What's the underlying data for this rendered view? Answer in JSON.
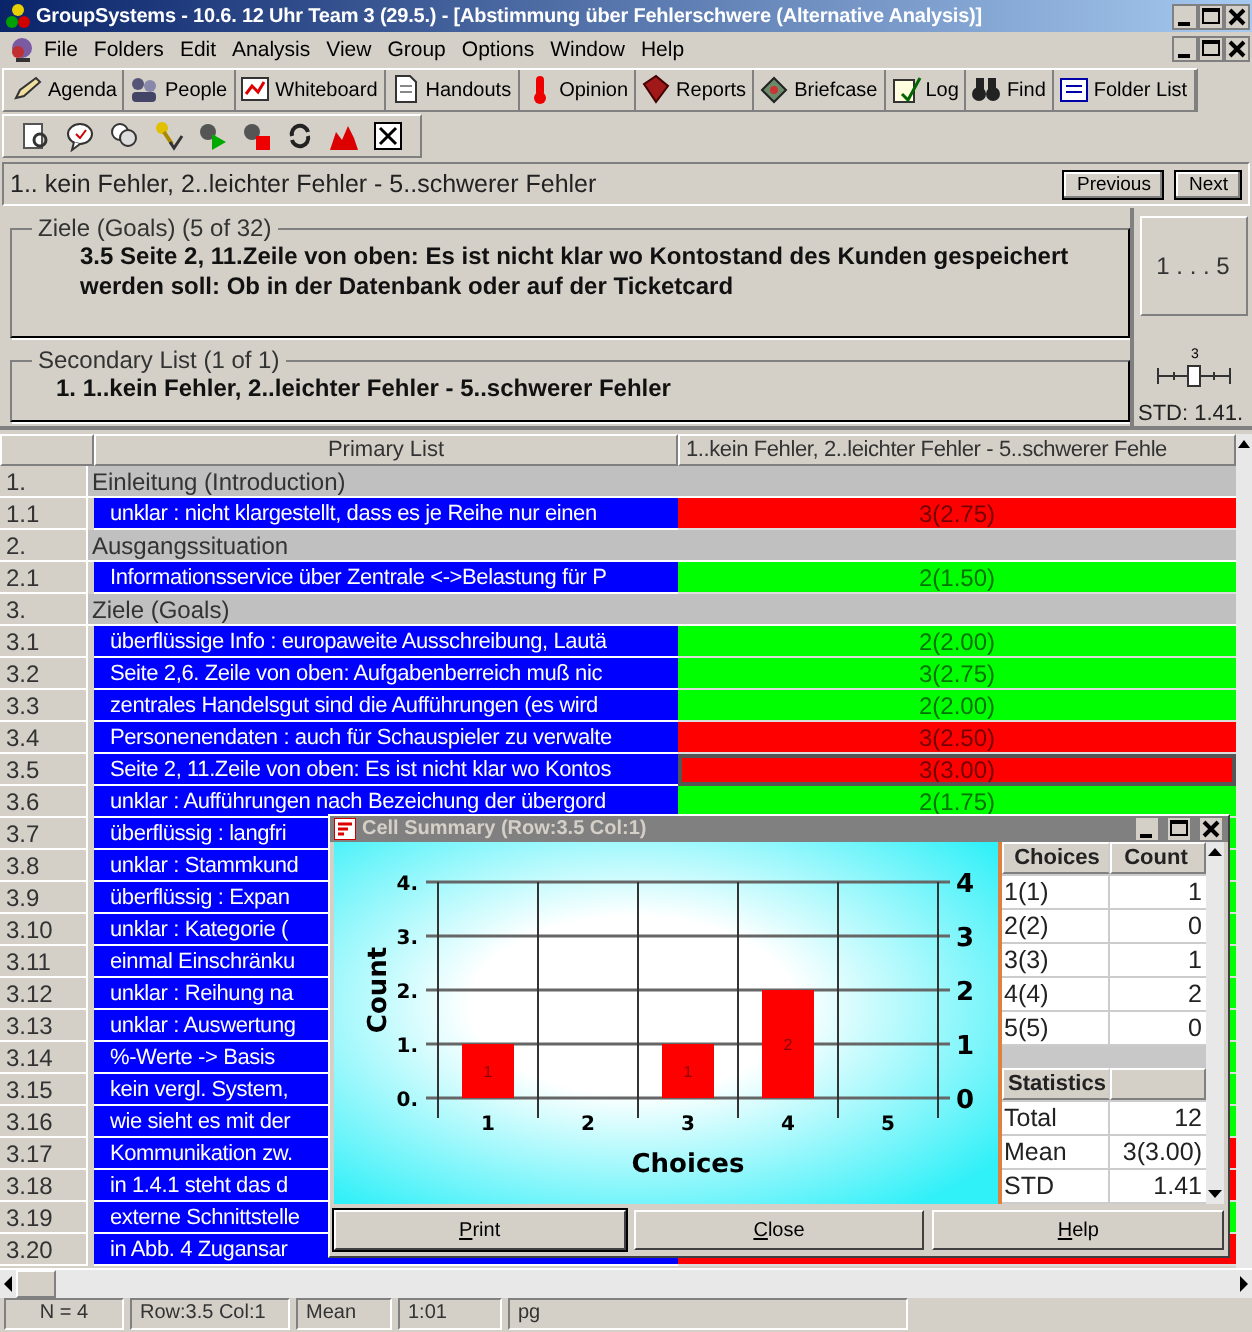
{
  "window": {
    "title": "GroupSystems - 10.6. 12 Uhr Team 3 (29.5.) - [Abstimmung über Fehlerschwere (Alternative Analysis)]"
  },
  "menu": [
    "File",
    "Folders",
    "Edit",
    "Analysis",
    "View",
    "Group",
    "Options",
    "Window",
    "Help"
  ],
  "toolbar": [
    "Agenda",
    "People",
    "Whiteboard",
    "Handouts",
    "Opinion",
    "Reports",
    "Briefcase",
    "Log",
    "Find",
    "Folder List"
  ],
  "prompt": {
    "text": "1.. kein Fehler, 2..leichter Fehler - 5..schwerer Fehler",
    "buttons": [
      "Previous",
      "Next"
    ]
  },
  "goals": {
    "legend": "Ziele (Goals) (5 of 32)",
    "text": "3.5 Seite 2, 11.Zeile von oben: Es ist nicht klar wo Kontostand des Kunden gespeichert werden soll: Ob in der Datenbank oder auf der Ticketcard"
  },
  "secondary": {
    "legend": "Secondary List (1 of 1)",
    "text": "1. 1..kein Fehler, 2..leichter Fehler - 5..schwerer Fehler"
  },
  "scale_panel": {
    "range": "1 . . . 5",
    "marker": "3",
    "std": "STD: 1.41."
  },
  "table": {
    "columns": [
      "Primary List",
      "1..kein Fehler, 2..leichter Fehler - 5..schwerer Fehle"
    ],
    "rows": [
      {
        "number": "1.",
        "kind": "heading",
        "text": "Einleitung (Introduction)"
      },
      {
        "number": "1.1",
        "kind": "item",
        "text": "unklar : nicht klargestellt, dass es je Reihe nur einen",
        "value": "3(2.75)",
        "color": "#ff0000",
        "selected": false
      },
      {
        "number": "2.",
        "kind": "heading",
        "text": "Ausgangssituation"
      },
      {
        "number": "2.1",
        "kind": "item",
        "text": "Informationsservice über Zentrale <->Belastung für P",
        "value": "2(1.50)",
        "color": "#00ff00",
        "selected": false
      },
      {
        "number": "3.",
        "kind": "heading",
        "text": "Ziele (Goals)"
      },
      {
        "number": "3.1",
        "kind": "item",
        "text": "überflüssige Info : europaweite Ausschreibung, Lautä",
        "value": "2(2.00)",
        "color": "#00ff00",
        "selected": false
      },
      {
        "number": "3.2",
        "kind": "item",
        "text": "Seite 2,6. Zeile von oben: Aufgabenberreich muß nic",
        "value": "3(2.75)",
        "color": "#00ff00",
        "selected": false
      },
      {
        "number": "3.3",
        "kind": "item",
        "text": "zentrales Handelsgut sind die Aufführungen (es wird",
        "value": "2(2.00)",
        "color": "#00ff00",
        "selected": false
      },
      {
        "number": "3.4",
        "kind": "item",
        "text": "Personenendaten : auch für Schauspieler zu verwalte",
        "value": "3(2.50)",
        "color": "#ff0000",
        "selected": false
      },
      {
        "number": "3.5",
        "kind": "item",
        "text": "Seite 2, 11.Zeile von oben: Es ist nicht klar wo Kontos",
        "value": "3(3.00)",
        "color": "#ff0000",
        "selected": true
      },
      {
        "number": "3.6",
        "kind": "item",
        "text": "unklar : Aufführungen nach Bezeichung der übergord",
        "value": "2(1.75)",
        "color": "#00ff00",
        "selected": false
      },
      {
        "number": "3.7",
        "kind": "item",
        "text": "überflüssig : langfri",
        "color": "#00ff00",
        "selected": false
      },
      {
        "number": "3.8",
        "kind": "item",
        "text": "unklar : Stammkund",
        "color": "#00ff00",
        "selected": false
      },
      {
        "number": "3.9",
        "kind": "item",
        "text": "überflüssig : Expan",
        "color": "#00ff00",
        "selected": false
      },
      {
        "number": "3.10",
        "kind": "item",
        "text": "unklar : Kategorie (",
        "color": "#00ff00",
        "selected": false
      },
      {
        "number": "3.11",
        "kind": "item",
        "text": "einmal Einschränku",
        "color": "#00ff00",
        "selected": false
      },
      {
        "number": "3.12",
        "kind": "item",
        "text": "unklar : Reihung na",
        "color": "#00ff00",
        "selected": false
      },
      {
        "number": "3.13",
        "kind": "item",
        "text": "unklar : Auswertung",
        "color": "#00ff00",
        "selected": false
      },
      {
        "number": "3.14",
        "kind": "item",
        "text": "%-Werte -> Basis",
        "color": "#00ff00",
        "selected": false
      },
      {
        "number": "3.15",
        "kind": "item",
        "text": "kein vergl. System,",
        "color": "#00ff00",
        "selected": false
      },
      {
        "number": "3.16",
        "kind": "item",
        "text": "wie sieht es mit der",
        "color": "#00ff00",
        "selected": false
      },
      {
        "number": "3.17",
        "kind": "item",
        "text": "Kommunikation zw.",
        "color": "#ff0000",
        "selected": false
      },
      {
        "number": "3.18",
        "kind": "item",
        "text": "in 1.4.1 steht das d",
        "color": "#ff0000",
        "selected": false
      },
      {
        "number": "3.19",
        "kind": "item",
        "text": "externe Schnittstelle",
        "color": "#00ff00",
        "selected": false
      },
      {
        "number": "3.20",
        "kind": "item",
        "text": "in Abb. 4 Zugansar",
        "color": "#ff0000",
        "selected": false
      }
    ]
  },
  "dialog": {
    "title": "Cell Summary (Row:3.5 Col:1)",
    "chart_data": {
      "type": "bar",
      "xlabel": "Choices",
      "ylabel": "Count",
      "categories": [
        "1",
        "2",
        "3",
        "4",
        "5"
      ],
      "values": [
        1,
        0,
        1,
        2,
        0
      ],
      "ylim": [
        0,
        4
      ],
      "yticks": [
        {
          "value": 0,
          "label": "0."
        },
        {
          "value": 1,
          "label": "1."
        },
        {
          "value": 2,
          "label": "2."
        },
        {
          "value": 3,
          "label": "3."
        },
        {
          "value": 4,
          "label": "4."
        }
      ],
      "annotations": [
        "0",
        "1",
        "2",
        "3",
        "4"
      ],
      "grid": true,
      "value_labels": [
        "1",
        null,
        "1",
        "2",
        null
      ]
    },
    "choices_table": {
      "columns": [
        "Choices",
        "Count"
      ],
      "rows": [
        [
          "1(1)",
          "1"
        ],
        [
          "2(2)",
          "0"
        ],
        [
          "3(3)",
          "1"
        ],
        [
          "4(4)",
          "2"
        ],
        [
          "5(5)",
          "0"
        ]
      ]
    },
    "statistics": {
      "heading": "Statistics",
      "rows": [
        [
          "Total",
          "12"
        ],
        [
          "Mean",
          "3(3.00)"
        ],
        [
          "STD",
          "1.41"
        ]
      ]
    },
    "buttons": [
      "Print",
      "Close",
      "Help"
    ]
  },
  "status_bar": [
    "N = 4",
    "Row:3.5 Col:1",
    "Mean",
    "1:01",
    "pg"
  ]
}
